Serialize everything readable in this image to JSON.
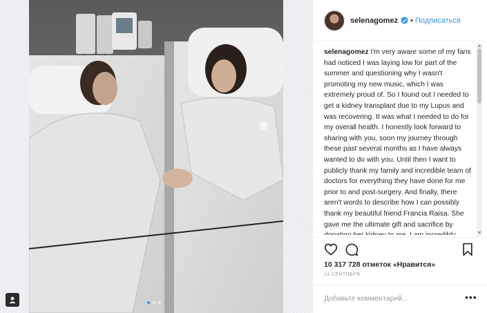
{
  "post": {
    "username": "selenagomez",
    "separator": "•",
    "follow_label": "Подписаться",
    "caption_user": "selenagomez",
    "caption_text": " I'm very aware some of my fans had noticed I was laying low for part of the summer and questioning why I wasn't promoting my new music, which I was extremely proud of. So I found out I needed to get a kidney transplant due to my Lupus and was recovering. It was what I needed to do for my overall health. I honestly look forward to sharing with you, soon my journey through these past several months as I have always wanted to do with you. Until then I want to publicly thank my family and incredible team of doctors for everything they have done for me prior to and post-surgery. And finally, there aren't words to describe how I can possibly thank my beautiful friend Francia Raisa. She gave me the ultimate gift and sacrifice by donating her kidney to me. I am incredibly blessed. I love you so much sis.",
    "likes_text": "10 317 728 отметок «Нравится»",
    "date_text": "14 сентября",
    "comment_placeholder": "Добавьте комментарий...",
    "more_label": "•••"
  },
  "icons": {
    "like": "heart-icon",
    "comment": "comment-icon",
    "save": "bookmark-icon",
    "verified": "verified-badge-icon",
    "tag": "user-tag-icon"
  },
  "colors": {
    "accent": "#3897f0",
    "text": "#262626",
    "muted": "#999999",
    "border": "#efefef"
  },
  "carousel": {
    "total": 3,
    "active": 1
  }
}
